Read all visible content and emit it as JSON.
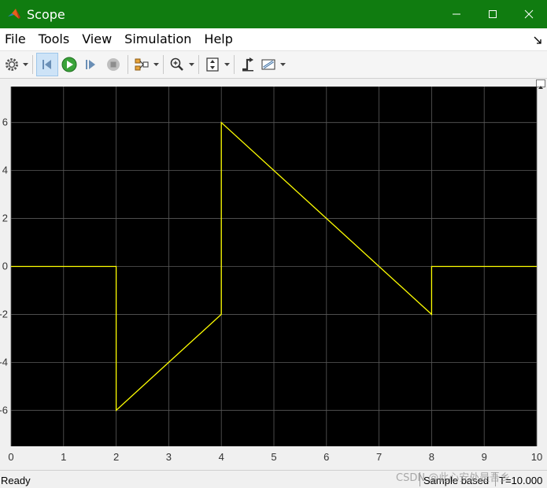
{
  "window": {
    "title": "Scope"
  },
  "menu": {
    "items": [
      "File",
      "Tools",
      "View",
      "Simulation",
      "Help"
    ]
  },
  "toolbar": {
    "buttons": [
      "settings-icon",
      "step-back-icon",
      "run-icon",
      "step-forward-icon",
      "stop-icon",
      "signal-selector-icon",
      "zoom-icon",
      "autoscale-icon",
      "trigger-icon",
      "measurements-icon"
    ]
  },
  "status": {
    "ready": "Ready",
    "sample": "Sample based",
    "time": "T=10.000"
  },
  "watermark": "CSDN @此心安处是吾乡",
  "chart_data": {
    "type": "line",
    "xlim": [
      0,
      10
    ],
    "ylim": [
      -7.5,
      7.5
    ],
    "xticks": [
      "0",
      "1",
      "2",
      "3",
      "4",
      "5",
      "6",
      "7",
      "8",
      "9",
      "10"
    ],
    "yticks": [
      "6",
      "4",
      "2",
      "0",
      "-2",
      "-4",
      "-6"
    ],
    "grid": true,
    "background": "#000000",
    "line_color": "#ffff00",
    "series": [
      {
        "x": [
          0,
          2,
          2,
          4,
          4,
          8,
          8,
          10
        ],
        "y": [
          0,
          0,
          -6,
          -2,
          6,
          -2,
          0,
          0
        ]
      }
    ]
  }
}
